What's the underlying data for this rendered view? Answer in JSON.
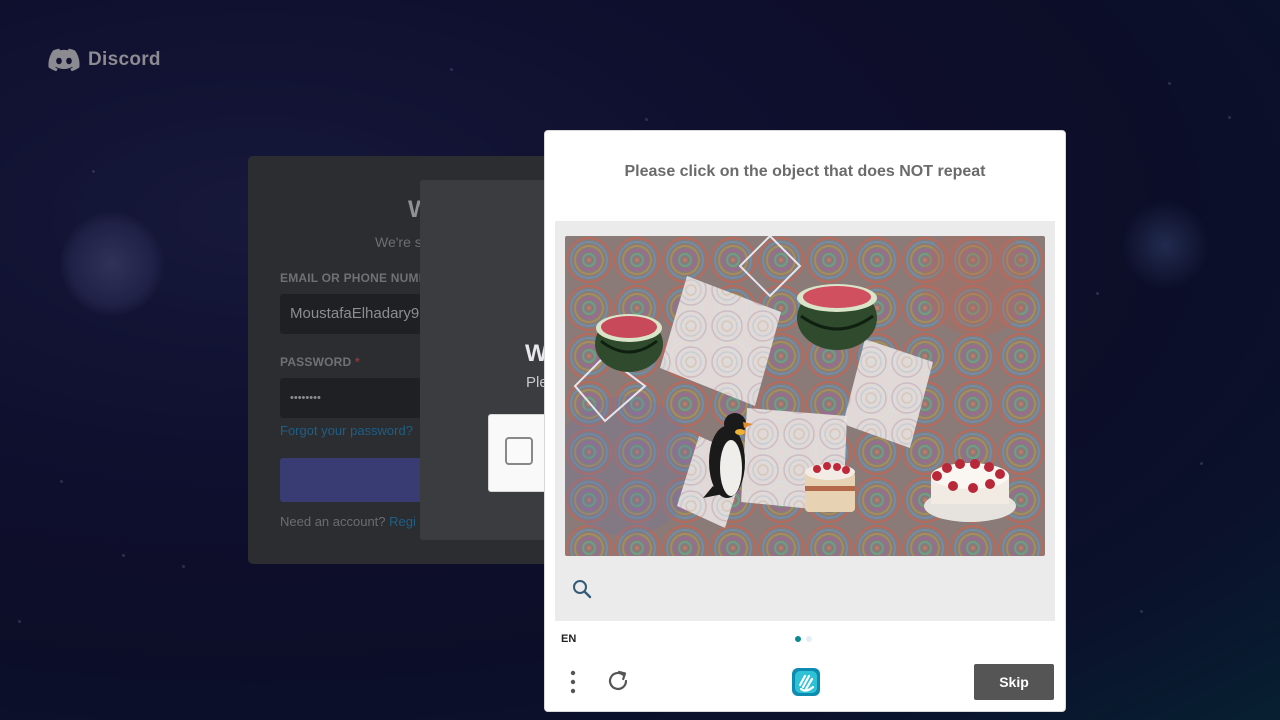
{
  "brand": {
    "name": "Discord",
    "icon": "discord-logo-icon"
  },
  "login": {
    "title": "W",
    "subtitle": "We're s",
    "email_label": "EMAIL OR PHONE NUMB",
    "email_value": "MoustafaElhadary9",
    "password_label": "PASSWORD",
    "required_mark": "*",
    "password_value": "••••••••",
    "forgot_link": "Forgot your password?",
    "need_account": "Need an account?",
    "register_link": "Regi"
  },
  "verify_modal": {
    "title": "W",
    "subtitle": "Ple"
  },
  "captcha": {
    "prompt": "Please click on the object that does NOT repeat",
    "language": "EN",
    "page_dots": {
      "total": 2,
      "active": 0
    },
    "skip_label": "Skip",
    "icons": {
      "zoom": "magnifier-icon",
      "menu": "vertical-dots-icon",
      "refresh": "refresh-icon",
      "logo": "hcaptcha-logo-icon"
    },
    "objects": [
      "watermelon",
      "watermelon",
      "penguin",
      "cake",
      "cake"
    ],
    "colors": {
      "accent": "#0b8a93",
      "skip_bg": "#555555"
    }
  }
}
